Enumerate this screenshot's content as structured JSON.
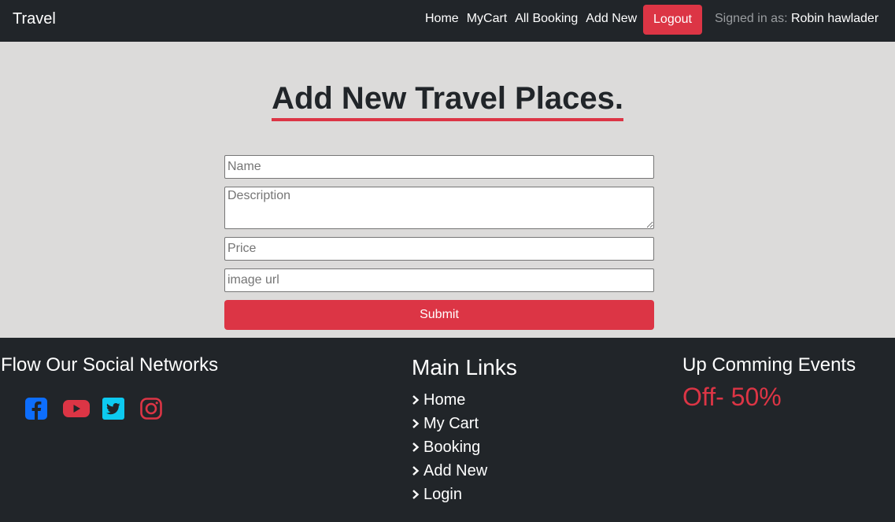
{
  "nav": {
    "brand": "Travel",
    "links": [
      "Home",
      "MyCart",
      "All Booking",
      "Add New"
    ],
    "logout": "Logout",
    "signed_label": "Signed in as:",
    "user": "Robin hawlader"
  },
  "main": {
    "title": "Add New Travel Places.",
    "name_placeholder": "Name",
    "description_placeholder": "Description",
    "price_placeholder": "Price",
    "image_placeholder": "image url",
    "submit": "Submit"
  },
  "footer": {
    "social_title": "Flow Our Social Networks",
    "social_icons": [
      {
        "name": "facebook-icon",
        "color": "#0d6efd"
      },
      {
        "name": "youtube-icon",
        "color": "#dc3545"
      },
      {
        "name": "twitter-icon",
        "color": "#0dcaf0"
      },
      {
        "name": "instagram-icon",
        "color": "#dc3545"
      }
    ],
    "links_title": "Main Links",
    "links": [
      "Home",
      "My Cart",
      "Booking",
      "Add New",
      "Login"
    ],
    "events_title": "Up Comming Events",
    "offer": "Off- 50%"
  },
  "colors": {
    "accent": "#dc3545",
    "dark": "#212529",
    "background": "#dcdbda"
  }
}
